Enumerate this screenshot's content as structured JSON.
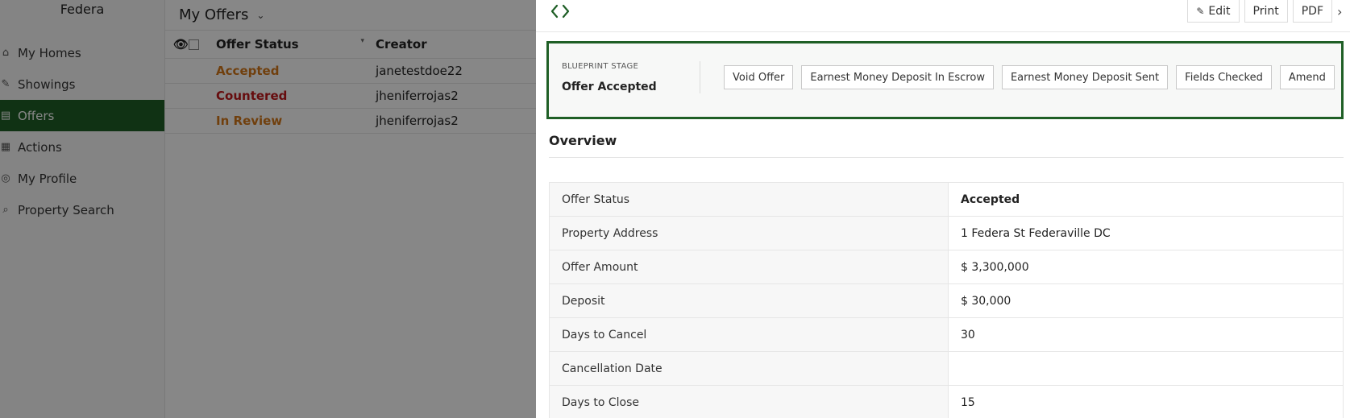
{
  "sidebar": {
    "brand": "Federa",
    "items": [
      {
        "label": "My Homes",
        "icon": "home-icon"
      },
      {
        "label": "Showings",
        "icon": "signpost-icon"
      },
      {
        "label": "Offers",
        "icon": "document-icon",
        "active": true
      },
      {
        "label": "Actions",
        "icon": "calendar-icon"
      },
      {
        "label": "My Profile",
        "icon": "profile-icon"
      },
      {
        "label": "Property Search",
        "icon": "search-icon"
      }
    ]
  },
  "list": {
    "title": "My Offers",
    "columns": [
      "Offer Status",
      "Creator"
    ],
    "rows": [
      {
        "status": "Accepted",
        "creator": "janetestdoe22"
      },
      {
        "status": "Countered",
        "creator": "jheniferrojas2"
      },
      {
        "status": "In Review",
        "creator": "jheniferrojas2"
      }
    ]
  },
  "panel": {
    "tools": {
      "edit": "Edit",
      "print": "Print",
      "pdf": "PDF"
    },
    "blueprint": {
      "label": "BLUEPRINT STAGE",
      "stage": "Offer Accepted",
      "actions": [
        "Void Offer",
        "Earnest Money Deposit In Escrow",
        "Earnest Money Deposit Sent",
        "Fields Checked",
        "Amend"
      ]
    },
    "overview": {
      "title": "Overview",
      "rows": [
        {
          "label": "Offer Status",
          "value": "Accepted"
        },
        {
          "label": "Property Address",
          "value": "1 Federa St Federaville DC"
        },
        {
          "label": "Offer Amount",
          "value": "$ 3,300,000"
        },
        {
          "label": "Deposit",
          "value": "$ 30,000"
        },
        {
          "label": "Days to Cancel",
          "value": "30"
        },
        {
          "label": "Cancellation Date",
          "value": ""
        },
        {
          "label": "Days to Close",
          "value": "15"
        }
      ]
    }
  },
  "colors": {
    "brand_green": "#1f5f26",
    "accepted": "#d4781a",
    "countered": "#c0181c",
    "link": "#1f6b2a"
  }
}
